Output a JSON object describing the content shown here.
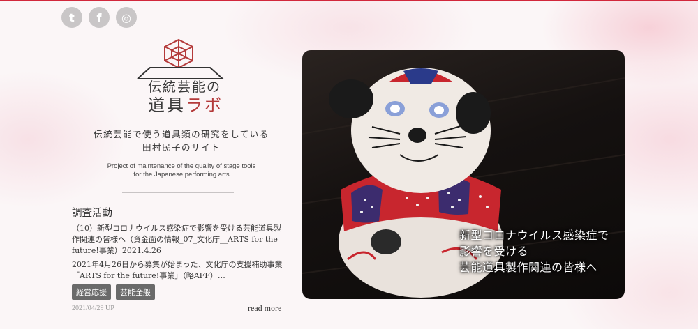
{
  "social": {
    "twitter_glyph": "t",
    "facebook_glyph": "f",
    "instagram_glyph": "◎"
  },
  "logo": {
    "line1": "伝統芸能の",
    "line2_main": "道具",
    "line2_accent": "ラボ"
  },
  "tagline": {
    "line1": "伝統芸能で使う道具類の研究をしている",
    "line2": "田村民子のサイト"
  },
  "subtitle_en": {
    "line1": "Project of maintenance of the quality of stage tools",
    "line2": "for the Japanese performing arts"
  },
  "section": {
    "title": "調査活動"
  },
  "post": {
    "title": "（10）新型コロナウイルス感染症で影響を受ける芸能道具製作関連の皆様へ（資金面の情報_07_文化庁__ARTS for the future!事業）2021.4.26",
    "excerpt": "2021年4月26日から募集が始まった、文化庁の支援補助事業「ARTS for the future!事業」（略AFF）…",
    "tags": [
      "経営応援",
      "芸能全般"
    ],
    "date": "2021/04/29 UP",
    "read_more": "read more"
  },
  "hero": {
    "caption": {
      "line1": "新型コロナウイルス感染症で",
      "line2": "影響を受ける",
      "line3": "芸能道具製作関連の皆様へ"
    }
  },
  "colors": {
    "accent": "#d2283c",
    "logo_red": "#b43a3a",
    "tag_bg": "#6a6a6a"
  }
}
